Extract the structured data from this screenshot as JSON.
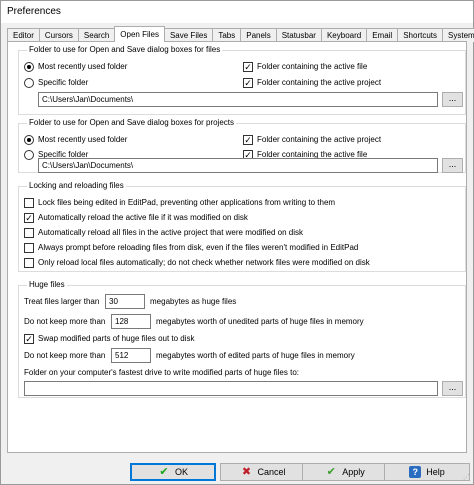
{
  "window": {
    "title": "Preferences"
  },
  "tabs": [
    "Editor",
    "Cursors",
    "Search",
    "Open Files",
    "Save Files",
    "Tabs",
    "Panels",
    "Statusbar",
    "Keyboard",
    "Email",
    "Shortcuts",
    "System"
  ],
  "active_tab": "Open Files",
  "files_group": {
    "title": "Folder to use for Open and Save dialog boxes for files",
    "most_recent_label": "Most recently used folder",
    "specific_label": "Specific folder",
    "selected": "Most recently used folder",
    "active_file_label": "Folder containing the active file",
    "active_file_checked": true,
    "active_project_label": "Folder containing the active project",
    "active_project_checked": true,
    "path": "C:\\Users\\Jan\\Documents\\",
    "browse_label": "..."
  },
  "projects_group": {
    "title": "Folder to use for Open and Save dialog boxes for projects",
    "most_recent_label": "Most recently used folder",
    "specific_label": "Specific folder",
    "selected": "Most recently used folder",
    "active_project_label": "Folder containing the active project",
    "active_project_checked": true,
    "active_file_label": "Folder containing the active file",
    "active_file_checked": true,
    "path": "C:\\Users\\Jan\\Documents\\",
    "browse_label": "..."
  },
  "locking_group": {
    "title": "Locking and reloading files",
    "options": [
      {
        "label": "Lock files being edited in EditPad, preventing other applications from writing to them",
        "checked": false
      },
      {
        "label": "Automatically reload the active file if it was modified on disk",
        "checked": true
      },
      {
        "label": "Automatically reload all files in the active project that were modified on disk",
        "checked": false
      },
      {
        "label": "Always prompt before reloading files from disk, even if the files weren't modified in EditPad",
        "checked": false
      },
      {
        "label": "Only reload local files automatically; do not check whether network files were modified on disk",
        "checked": false
      }
    ]
  },
  "huge_group": {
    "title": "Huge files",
    "treat_prefix": "Treat files larger than",
    "treat_value": "30",
    "treat_suffix": "megabytes as huge files",
    "unedited_prefix": "Do not keep more than",
    "unedited_value": "128",
    "unedited_suffix": "megabytes worth of unedited parts of huge files in memory",
    "swap_label": "Swap modified parts of huge files out to disk",
    "swap_checked": true,
    "edited_prefix": "Do not keep more than",
    "edited_value": "512",
    "edited_suffix": "megabytes worth of edited parts of huge files in memory",
    "swap_folder_label": "Folder on your computer's fastest drive to write modified parts of huge files to:",
    "swap_folder_value": "",
    "browse_label": "..."
  },
  "buttons": {
    "ok": "OK",
    "cancel": "Cancel",
    "apply": "Apply",
    "help": "Help"
  },
  "icons": {
    "ok": "check-icon",
    "cancel": "cross-icon",
    "apply": "check-icon",
    "help": "question-icon"
  }
}
